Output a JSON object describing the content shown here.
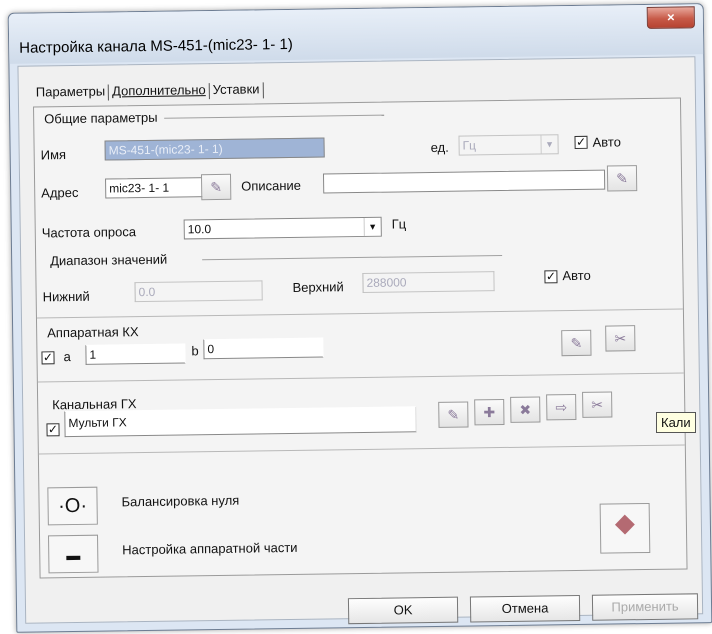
{
  "window": {
    "title": "Настройка канала MS-451-(mic23- 1- 1)",
    "close_label": "×"
  },
  "tabs": [
    {
      "label": "Параметры",
      "active": true
    },
    {
      "label": "Дополнительно",
      "active": false
    },
    {
      "label": "Уставки",
      "active": false
    }
  ],
  "general": {
    "group_label": "Общие параметры",
    "name_label": "Имя",
    "name_value": "MS-451-(mic23- 1- 1)",
    "unit_label": "ед.",
    "unit_value": "Гц",
    "auto_label": "Авто",
    "auto_checked": true,
    "address_label": "Адрес",
    "address_value": "mic23- 1- 1",
    "description_label": "Описание",
    "description_value": "",
    "rate_label": "Частота опроса",
    "rate_value": "10.0",
    "rate_unit": "Гц"
  },
  "range": {
    "group_label": "Диапазон значений",
    "lower_label": "Нижний",
    "lower_value": "0.0",
    "upper_label": "Верхний",
    "upper_value": "288000",
    "auto_label": "Авто",
    "auto_checked": true
  },
  "hardware_cx": {
    "group_label": "Аппаратная КХ",
    "a_label": "а",
    "a_value": "1",
    "b_label": "b",
    "b_value": "0",
    "enabled": true
  },
  "channel_gx": {
    "group_label": "Канальная ГХ",
    "multi_label": "Мульти ГХ",
    "multi_checked": true
  },
  "tooltip": "Кали",
  "actions": {
    "zero_balance_label": "Балансировка нуля",
    "hardware_setup_label": "Настройка аппаратной части"
  },
  "buttons": {
    "ok": "OK",
    "cancel": "Отмена",
    "apply": "Применить"
  }
}
